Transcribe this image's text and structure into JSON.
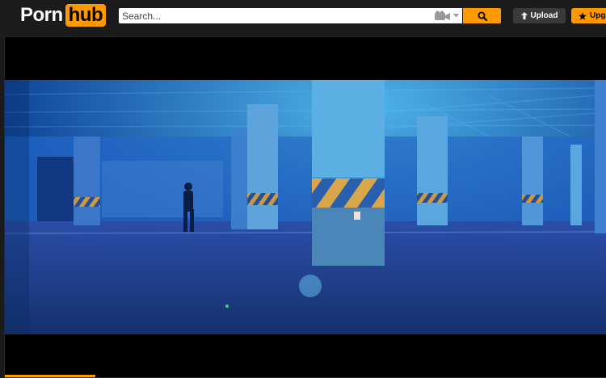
{
  "header": {
    "logo_part1": "Porn",
    "logo_part2": "hub",
    "search_placeholder": "Search...",
    "upload_label": "Upload",
    "upgrade_label": "Upg"
  },
  "icons": {
    "search": "search-icon",
    "camera": "video-camera-icon",
    "dropdown": "chevron-down-icon",
    "upload": "upload-arrow-icon",
    "upgrade": "star-icon"
  },
  "player": {
    "progress_fraction": 0.15
  },
  "colors": {
    "accent": "#ff9900",
    "background": "#1b1b1b",
    "player_bg": "#000000"
  }
}
